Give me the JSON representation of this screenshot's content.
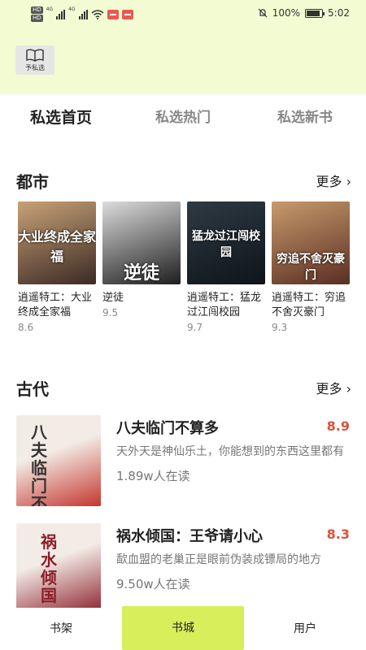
{
  "status_bar": {
    "hd1": "HD",
    "hd2": "HD",
    "net1": "4G",
    "net2": "4G",
    "battery_pct": "100%",
    "time": "5:02",
    "icons": [
      "signal-icon",
      "wifi-icon",
      "notification-badge-icon",
      "mute-icon",
      "battery-icon"
    ]
  },
  "header": {
    "pick_label": "予私选",
    "pick_icon": "book-icon"
  },
  "tabs": [
    {
      "label": "私选首页",
      "active": true
    },
    {
      "label": "私选热门",
      "active": false
    },
    {
      "label": "私选新书",
      "active": false
    }
  ],
  "urban": {
    "title": "都市",
    "more": "更多 ›",
    "books": [
      {
        "title": "逍遥特工：大业终成全家福",
        "score": "8.6",
        "cover_text": "大业终成全家福",
        "cover_colors": [
          "#c8a276",
          "#3b2a24"
        ]
      },
      {
        "title": "逆徒",
        "score": "9.5",
        "cover_text": "逆徒",
        "cover_colors": [
          "#dcdcdc",
          "#1e1e1e"
        ]
      },
      {
        "title": "逍遥特工：猛龙过江闯校园",
        "score": "9.7",
        "cover_text": "猛龙过江闯校园",
        "cover_colors": [
          "#2e3a44",
          "#0e141a"
        ]
      },
      {
        "title": "逍遥特工：穷追不舍灭豪门",
        "score": "9.3",
        "cover_text": "穷追不舍灭豪门",
        "cover_colors": [
          "#c79a6d",
          "#5a2e22"
        ]
      }
    ]
  },
  "ancient": {
    "title": "古代",
    "more": "更多 ›",
    "books": [
      {
        "title": "八夫临门不算多",
        "score": "8.9",
        "desc": "天外天是神仙乐土，你能想到的东西这里都有",
        "readers": "1.89w人在读",
        "cover_text": "八夫临门不算多",
        "cover_colors": [
          "#f2ece4",
          "#c5352f"
        ]
      },
      {
        "title": "祸水倾国：王爷请小心",
        "score": "8.3",
        "desc": "歃血盟的老巢正是眼前伪装成镖局的地方",
        "readers": "9.50w人在读",
        "cover_text": "祸水倾国",
        "cover_colors": [
          "#f3ece6",
          "#8a1f2a"
        ]
      }
    ]
  },
  "bottom_nav": [
    {
      "label": "书架",
      "active": false
    },
    {
      "label": "书城",
      "active": true
    },
    {
      "label": "用户",
      "active": false
    }
  ]
}
